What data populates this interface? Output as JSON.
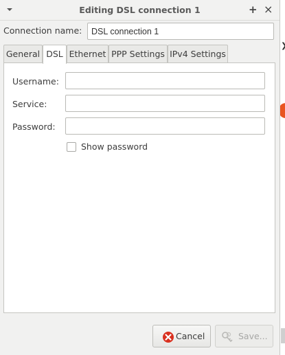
{
  "window": {
    "title": "Editing DSL connection 1",
    "menu_icon": "chevron-down-icon",
    "maximize_icon": "plus-icon",
    "close_icon": "close-icon"
  },
  "connection": {
    "label": "Connection name:",
    "value": "DSL connection 1"
  },
  "tabs": [
    {
      "label": "General",
      "active": false
    },
    {
      "label": "DSL",
      "active": true
    },
    {
      "label": "Ethernet",
      "active": false
    },
    {
      "label": "PPP Settings",
      "active": false
    },
    {
      "label": "IPv4 Settings",
      "active": false
    }
  ],
  "dsl": {
    "username_label": "Username:",
    "username_value": "",
    "service_label": "Service:",
    "service_value": "",
    "password_label": "Password:",
    "password_value": "",
    "show_password_label": "Show password",
    "show_password_checked": false
  },
  "buttons": {
    "cancel_label": "Cancel",
    "cancel_icon": "cancel-icon",
    "save_label": "Save...",
    "save_icon": "keys-icon",
    "save_enabled": false
  },
  "colors": {
    "cancel_icon": "#d9301f",
    "background_accent": "#e95420"
  }
}
